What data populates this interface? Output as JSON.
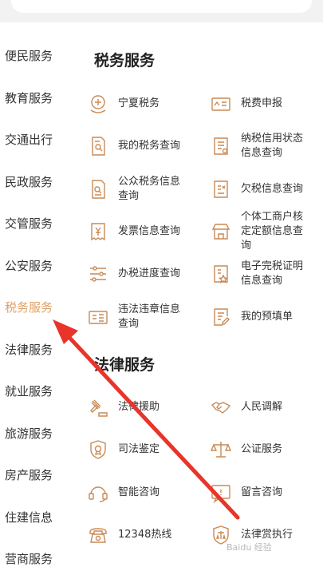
{
  "sidebar": {
    "items": [
      {
        "label": "便民服务"
      },
      {
        "label": "教育服务"
      },
      {
        "label": "交通出行"
      },
      {
        "label": "民政服务"
      },
      {
        "label": "交管服务"
      },
      {
        "label": "公安服务"
      },
      {
        "label": "税务服务"
      },
      {
        "label": "法律服务"
      },
      {
        "label": "就业服务"
      },
      {
        "label": "旅游服务"
      },
      {
        "label": "房产服务"
      },
      {
        "label": "住建信息"
      },
      {
        "label": "营商服务"
      }
    ],
    "active_index": 6
  },
  "sections": [
    {
      "title": "税务服务",
      "items": [
        {
          "label": "宁夏税务",
          "icon": "tax-badge-icon"
        },
        {
          "label": "税费申报",
          "icon": "tax-declare-icon"
        },
        {
          "label": "我的税务查询",
          "icon": "document-search-icon"
        },
        {
          "label": "纳税信用状态信息查询",
          "icon": "list-document-icon"
        },
        {
          "label": "公众税务信息查询",
          "icon": "document-search-icon"
        },
        {
          "label": "欠税信息查询",
          "icon": "tax-document-icon"
        },
        {
          "label": "发票信息查询",
          "icon": "invoice-icon"
        },
        {
          "label": "个体工商户核定定额信息查询",
          "icon": "shop-icon"
        },
        {
          "label": "办税进度查询",
          "icon": "sliders-icon"
        },
        {
          "label": "电子完税证明信息查询",
          "icon": "tax-certificate-icon"
        },
        {
          "label": "违法违章信息查询",
          "icon": "violation-icon"
        },
        {
          "label": "我的预填单",
          "icon": "edit-form-icon"
        }
      ]
    },
    {
      "title": "法律服务",
      "items": [
        {
          "label": "法律援助",
          "icon": "gavel-icon"
        },
        {
          "label": "人民调解",
          "icon": "handshake-icon"
        },
        {
          "label": "司法鉴定",
          "icon": "shield-badge-icon"
        },
        {
          "label": "公证服务",
          "icon": "scales-icon"
        },
        {
          "label": "智能咨询",
          "icon": "headset-icon"
        },
        {
          "label": "留言咨询",
          "icon": "message-icon"
        },
        {
          "label": "12348热线",
          "icon": "telephone-icon"
        },
        {
          "label": "法律赏执行",
          "icon": "shield-law-icon"
        }
      ]
    }
  ],
  "watermark": "Baidu 经验",
  "colors": {
    "accent": "#e0a064",
    "icon": "#c98a55",
    "arrow": "#e8342a",
    "text": "#333333"
  }
}
